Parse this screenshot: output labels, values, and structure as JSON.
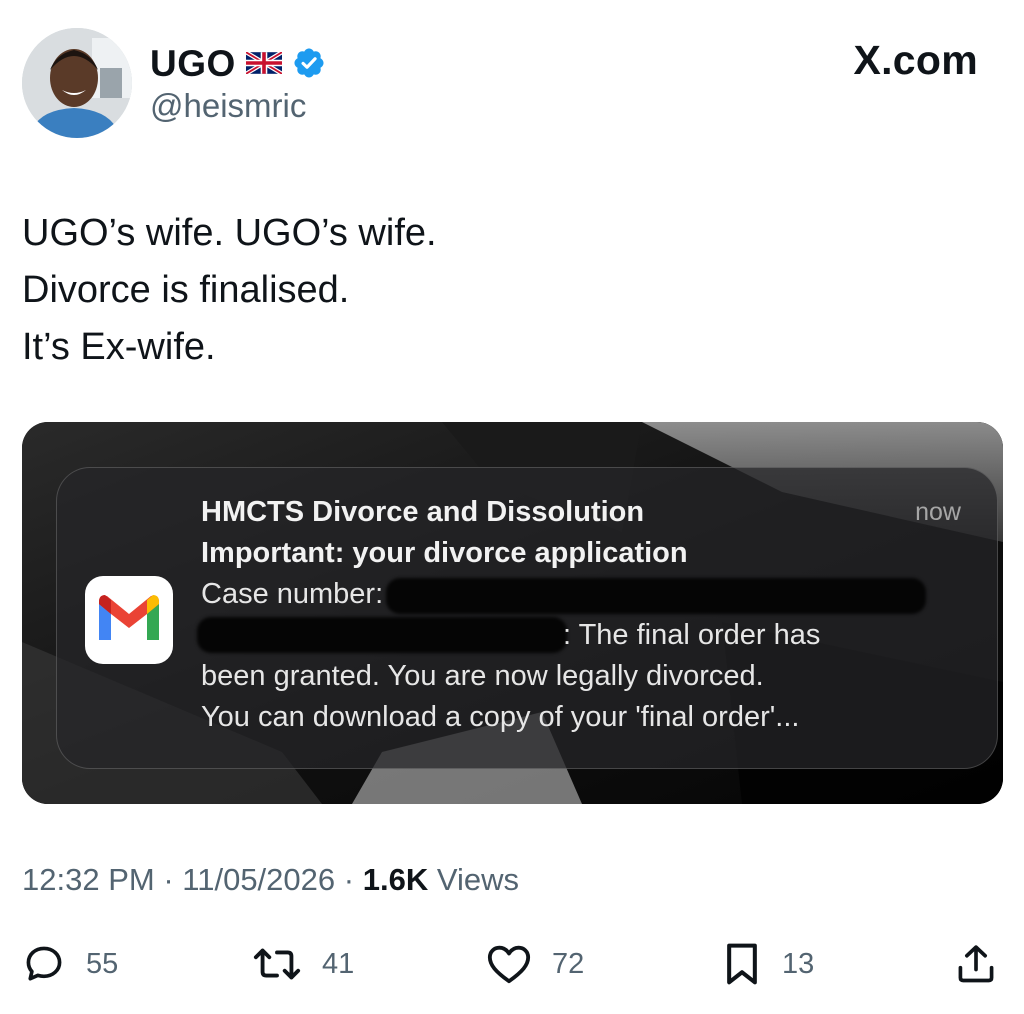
{
  "header": {
    "display_name": "UGO",
    "handle": "@heismric",
    "site": "X.com",
    "verified_color": "#1d9bf0"
  },
  "tweet": {
    "lines": [
      "UGO’s wife. UGO’s wife.",
      "Divorce is finalised.",
      "It’s Ex-wife."
    ]
  },
  "notification": {
    "app_icon": "gmail-icon",
    "sender": "HMCTS Divorce and Dissolution",
    "subject": "Important: your divorce application",
    "case_label": "Case number:",
    "body_line_2": ": The final order has",
    "body_line_3": "been granted. You are now legally divorced.",
    "body_line_4": "You can download a copy of your 'final order'...",
    "time": "now"
  },
  "meta": {
    "time": "12:32 PM",
    "separator": "·",
    "date": "11/05/2026",
    "views_count": "1.6K",
    "views_label": "Views"
  },
  "actions": {
    "replies": "55",
    "reposts": "41",
    "likes": "72",
    "bookmarks": "13"
  },
  "icons": [
    "uk-flag-icon",
    "verified-badge-icon",
    "reply-icon",
    "repost-icon",
    "like-icon",
    "bookmark-icon",
    "share-icon"
  ]
}
